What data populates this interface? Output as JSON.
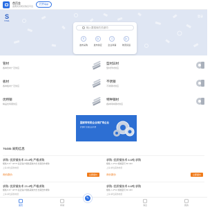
{
  "header": {
    "app_name": "首页金",
    "app_sub": "金属实货成交信息平台",
    "open_app": "打开App"
  },
  "hero": {
    "logo_text": "S",
    "logo_sub": "STEEL",
    "login": "登录"
  },
  "search": {
    "placeholder": "输入要搜索的关键词"
  },
  "quick_links": [
    {
      "icon": "doc-icon",
      "glyph": "≡",
      "label": "发布采购"
    },
    {
      "icon": "tag-icon",
      "glyph": "◇",
      "label": "发布供应"
    },
    {
      "icon": "box-icon",
      "glyph": "□",
      "label": "企业商铺"
    },
    {
      "icon": "truck-icon",
      "glyph": "▷",
      "label": "物流货运"
    }
  ],
  "categories": [
    {
      "title": "管材",
      "sub": "各种管材广泛供应",
      "icon": "pipe-icon"
    },
    {
      "title": "型材异材",
      "sub": "型材异材供应",
      "icon": "profile-icon"
    },
    {
      "title": "板材",
      "sub": "各种板材广泛供应",
      "icon": "plate-icon"
    },
    {
      "title": "不锈钢",
      "sub": "不锈钢材供应",
      "icon": "stainless-icon"
    },
    {
      "title": "优特钢",
      "sub": "精品优特钢供应",
      "icon": "bar-icon"
    },
    {
      "title": "特种钢材",
      "sub": "各种特种钢材供应",
      "icon": "coil-icon"
    }
  ],
  "banner": {
    "line1": "国家带有助企业来扩带企业",
    "line2": "好钢材 全国店店有用"
  },
  "section": {
    "title": "76485 采购信息"
  },
  "listings": [
    {
      "left": {
        "title": "求购: 优质钢技术 23.4吨 严格求购",
        "desc": "规格:5.6个 30*75 接近客户规格采购方式:长期合作求购",
        "meta": "上海 单位其他材质",
        "price": "询价报价"
      },
      "right": {
        "title": "求购: 优质钢技术 6.6吨 求购",
        "desc": "规格: 1.4*5.6 规格型号 8X 30X",
        "meta": "上海 单位其他材质",
        "price": "询价报价"
      },
      "btn": "立即报价"
    },
    {
      "left": {
        "title": "求购: 优质钢技术 23.4吨 严格求购",
        "desc": "规格:5.6个 30*75 接近客户规格采购方式:长期合作求购",
        "meta": "上海 单位其他材质",
        "price": "询价报价"
      },
      "right": {
        "title": "求购: 优质钢技术 6.6吨 求购",
        "desc": "规格: 1.4*5.6 规格型号 8X 30X",
        "meta": "上海 单位其他材质",
        "price": "询价报价"
      },
      "btn": "立即报价"
    }
  ],
  "bottom_nav": [
    {
      "icon": "home-icon",
      "label": "首页"
    },
    {
      "icon": "shop-icon",
      "label": "商城"
    },
    {
      "icon": "publish-icon",
      "label": "发布"
    },
    {
      "icon": "message-icon",
      "label": "消息"
    },
    {
      "icon": "user-icon",
      "label": "我的"
    }
  ],
  "colors": {
    "accent": "#2b6fe3",
    "orange": "#f07b1a"
  }
}
